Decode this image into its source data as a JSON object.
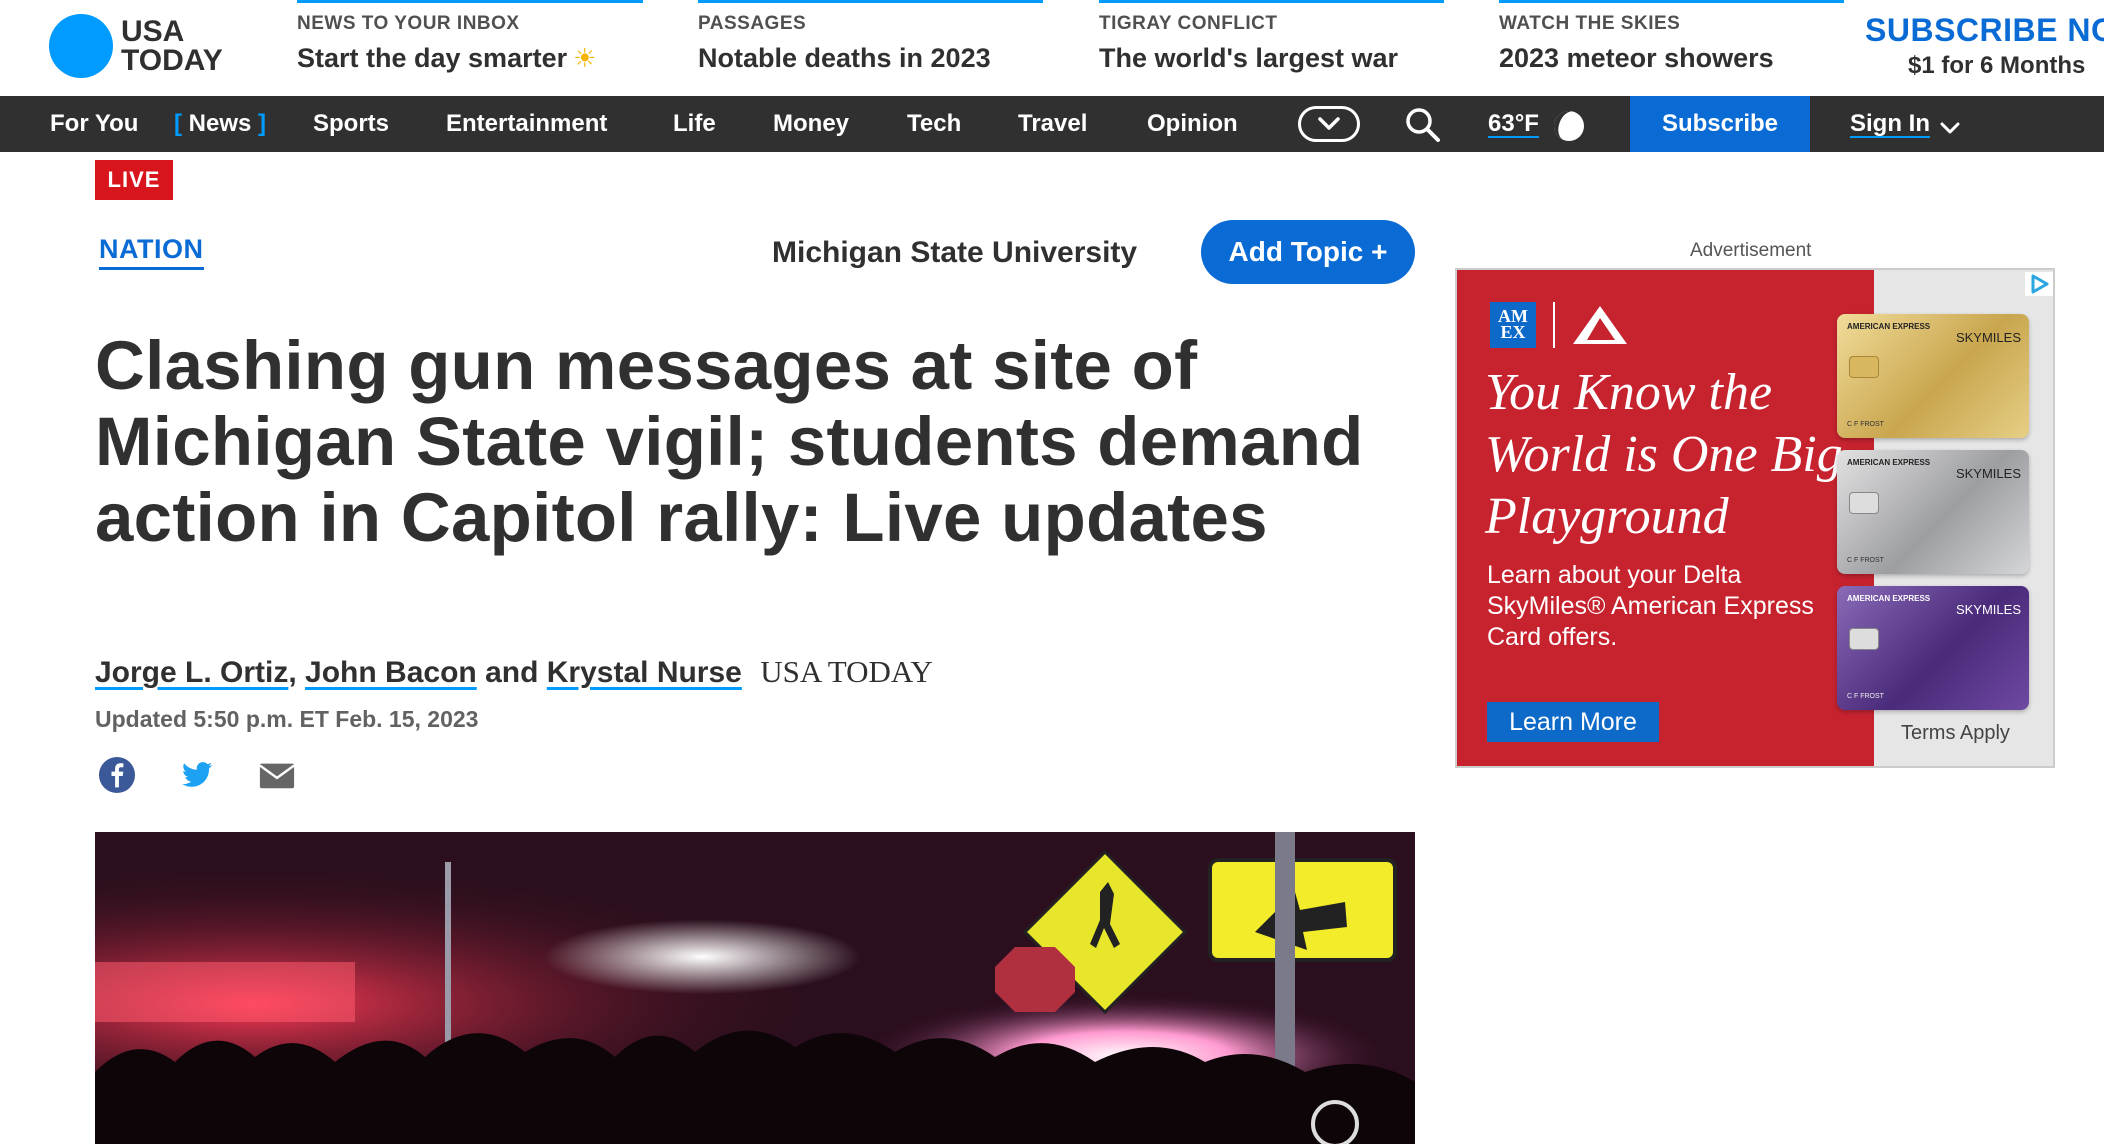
{
  "brand": {
    "line1": "USA",
    "line2": "TODAY",
    "color": "#009bff"
  },
  "promos": [
    {
      "kicker": "NEWS TO YOUR INBOX",
      "headline": "Start the day smarter"
    },
    {
      "kicker": "PASSAGES",
      "headline": "Notable deaths in 2023"
    },
    {
      "kicker": "TIGRAY CONFLICT",
      "headline": "The world's largest war"
    },
    {
      "kicker": "WATCH THE SKIES",
      "headline": "2023 meteor showers"
    }
  ],
  "subscribe_promo": {
    "title": "SUBSCRIBE NOW",
    "offer": "$1 for 6 Months"
  },
  "nav": {
    "items": [
      "For You",
      "News",
      "Sports",
      "Entertainment",
      "Life",
      "Money",
      "Tech",
      "Travel",
      "Opinion"
    ],
    "active_item": "News",
    "temperature": "63°F",
    "subscribe": "Subscribe",
    "sign_in": "Sign In",
    "more_icon": "chevron-down-pill-icon",
    "search_icon": "search-icon",
    "weather_icon": "moon-icon"
  },
  "article": {
    "live_badge": "LIVE",
    "section": "NATION",
    "topic": "Michigan State University",
    "add_topic": "Add Topic +",
    "headline": "Clashing gun messages at site of Michigan State vigil; students demand action in Capitol rally: Live updates",
    "authors": [
      "Jorge L. Ortiz",
      "John Bacon",
      "Krystal Nurse"
    ],
    "byline_sep": ",",
    "byline_and": "and",
    "byline_source": "USA TODAY",
    "updated": "Updated 5:50 p.m. ET Feb. 15, 2023",
    "share_icons": [
      "facebook-icon",
      "twitter-icon",
      "email-icon"
    ]
  },
  "advertisement": {
    "label": "Advertisement",
    "amex_logo": "AM EX",
    "tagline": "You Know the World is One Big Playground",
    "copy": "Learn about your Delta SkyMiles® American Express Card offers.",
    "cta": "Learn More",
    "terms": "Terms Apply",
    "card_issuer": "AMERICAN EXPRESS",
    "card_program": "SKYMILES",
    "card_holder": "C F FROST",
    "colors": {
      "red": "#c6232f",
      "blue": "#0d6ac8"
    }
  },
  "colors": {
    "accent": "#009bff",
    "link": "#0a6bd5",
    "live": "#d8141d",
    "nav_bg": "#303030"
  }
}
